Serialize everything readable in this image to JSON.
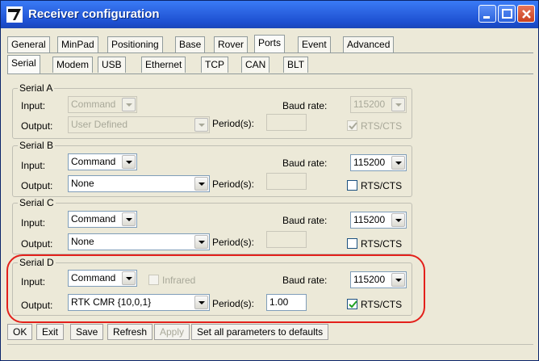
{
  "window": {
    "title": "Receiver configuration"
  },
  "tabs_main": [
    "General",
    "MinPad",
    "Positioning",
    "Base",
    "Rover",
    "Ports",
    "Event",
    "Advanced"
  ],
  "tabs_sub": [
    "Serial",
    "Modem",
    "USB",
    "Ethernet",
    "TCP",
    "CAN",
    "BLT"
  ],
  "labels": {
    "input": "Input:",
    "output": "Output:",
    "baud_rate": "Baud rate:",
    "period": "Period(s):",
    "rtscts": "RTS/CTS",
    "infrared": "Infrared"
  },
  "serial_a": {
    "name": "Serial A",
    "input": "Command",
    "output": "User Defined",
    "baud": "115200",
    "period": "",
    "rtscts": true
  },
  "serial_b": {
    "name": "Serial B",
    "input": "Command",
    "output": "None",
    "baud": "115200",
    "period": "",
    "rtscts": false
  },
  "serial_c": {
    "name": "Serial C",
    "input": "Command",
    "output": "None",
    "baud": "115200",
    "period": "",
    "rtscts": false
  },
  "serial_d": {
    "name": "Serial D",
    "input": "Command",
    "output": "RTK CMR {10,0,1}",
    "baud": "115200",
    "period": "1.00",
    "rtscts": true,
    "infrared": false
  },
  "buttons": {
    "ok": "OK",
    "exit": "Exit",
    "save": "Save",
    "refresh": "Refresh",
    "apply": "Apply",
    "defaults": "Set all parameters to defaults"
  },
  "colors": {
    "title_bar": "#2a62e0",
    "highlight": "#e3201b",
    "window_bg": "#ece9d8"
  }
}
